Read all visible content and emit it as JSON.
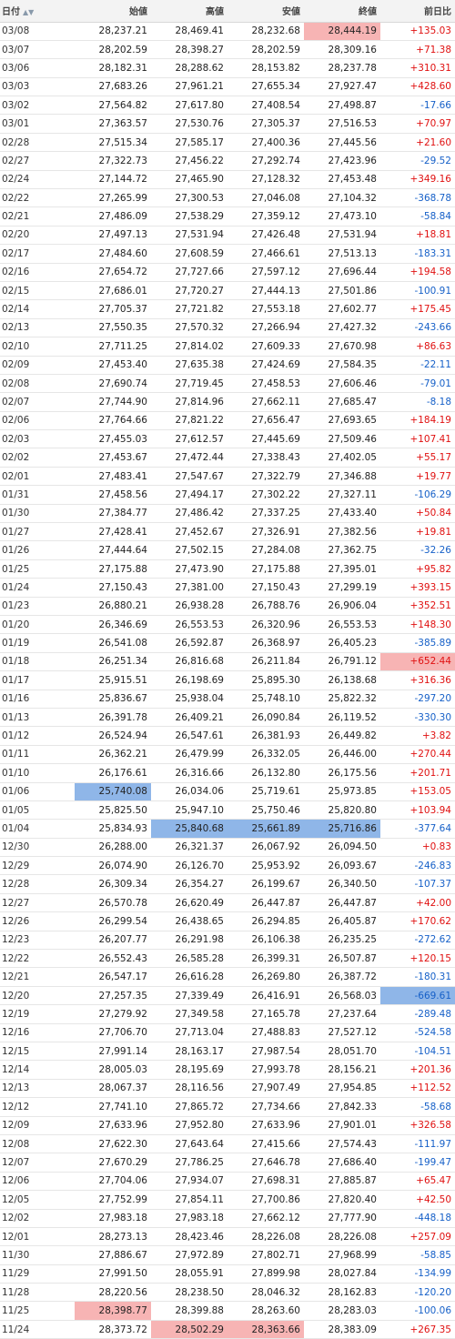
{
  "headers": {
    "date": "日付",
    "open": "始値",
    "high": "高値",
    "low": "安値",
    "close": "終値",
    "change": "前日比"
  },
  "sort_icons": "▲▼",
  "highlight_colors": {
    "high": "#f7b4b4",
    "low": "#8fb6e8",
    "positive": "#e01010",
    "negative": "#1660c8"
  },
  "rows": [
    {
      "date": "03/08",
      "open": "28,237.21",
      "high": "28,469.41",
      "low": "28,232.68",
      "close": "28,444.19",
      "change": "+135.03",
      "hl": {
        "close": "hi"
      }
    },
    {
      "date": "03/07",
      "open": "28,202.59",
      "high": "28,398.27",
      "low": "28,202.59",
      "close": "28,309.16",
      "change": "+71.38"
    },
    {
      "date": "03/06",
      "open": "28,182.31",
      "high": "28,288.62",
      "low": "28,153.82",
      "close": "28,237.78",
      "change": "+310.31"
    },
    {
      "date": "03/03",
      "open": "27,683.26",
      "high": "27,961.21",
      "low": "27,655.34",
      "close": "27,927.47",
      "change": "+428.60"
    },
    {
      "date": "03/02",
      "open": "27,564.82",
      "high": "27,617.80",
      "low": "27,408.54",
      "close": "27,498.87",
      "change": "-17.66"
    },
    {
      "date": "03/01",
      "open": "27,363.57",
      "high": "27,530.76",
      "low": "27,305.37",
      "close": "27,516.53",
      "change": "+70.97"
    },
    {
      "date": "02/28",
      "open": "27,515.34",
      "high": "27,585.17",
      "low": "27,400.36",
      "close": "27,445.56",
      "change": "+21.60"
    },
    {
      "date": "02/27",
      "open": "27,322.73",
      "high": "27,456.22",
      "low": "27,292.74",
      "close": "27,423.96",
      "change": "-29.52"
    },
    {
      "date": "02/24",
      "open": "27,144.72",
      "high": "27,465.90",
      "low": "27,128.32",
      "close": "27,453.48",
      "change": "+349.16"
    },
    {
      "date": "02/22",
      "open": "27,265.99",
      "high": "27,300.53",
      "low": "27,046.08",
      "close": "27,104.32",
      "change": "-368.78"
    },
    {
      "date": "02/21",
      "open": "27,486.09",
      "high": "27,538.29",
      "low": "27,359.12",
      "close": "27,473.10",
      "change": "-58.84"
    },
    {
      "date": "02/20",
      "open": "27,497.13",
      "high": "27,531.94",
      "low": "27,426.48",
      "close": "27,531.94",
      "change": "+18.81"
    },
    {
      "date": "02/17",
      "open": "27,484.60",
      "high": "27,608.59",
      "low": "27,466.61",
      "close": "27,513.13",
      "change": "-183.31"
    },
    {
      "date": "02/16",
      "open": "27,654.72",
      "high": "27,727.66",
      "low": "27,597.12",
      "close": "27,696.44",
      "change": "+194.58"
    },
    {
      "date": "02/15",
      "open": "27,686.01",
      "high": "27,720.27",
      "low": "27,444.13",
      "close": "27,501.86",
      "change": "-100.91"
    },
    {
      "date": "02/14",
      "open": "27,705.37",
      "high": "27,721.82",
      "low": "27,553.18",
      "close": "27,602.77",
      "change": "+175.45"
    },
    {
      "date": "02/13",
      "open": "27,550.35",
      "high": "27,570.32",
      "low": "27,266.94",
      "close": "27,427.32",
      "change": "-243.66"
    },
    {
      "date": "02/10",
      "open": "27,711.25",
      "high": "27,814.02",
      "low": "27,609.33",
      "close": "27,670.98",
      "change": "+86.63"
    },
    {
      "date": "02/09",
      "open": "27,453.40",
      "high": "27,635.38",
      "low": "27,424.69",
      "close": "27,584.35",
      "change": "-22.11"
    },
    {
      "date": "02/08",
      "open": "27,690.74",
      "high": "27,719.45",
      "low": "27,458.53",
      "close": "27,606.46",
      "change": "-79.01"
    },
    {
      "date": "02/07",
      "open": "27,744.90",
      "high": "27,814.96",
      "low": "27,662.11",
      "close": "27,685.47",
      "change": "-8.18"
    },
    {
      "date": "02/06",
      "open": "27,764.66",
      "high": "27,821.22",
      "low": "27,656.47",
      "close": "27,693.65",
      "change": "+184.19"
    },
    {
      "date": "02/03",
      "open": "27,455.03",
      "high": "27,612.57",
      "low": "27,445.69",
      "close": "27,509.46",
      "change": "+107.41"
    },
    {
      "date": "02/02",
      "open": "27,453.67",
      "high": "27,472.44",
      "low": "27,338.43",
      "close": "27,402.05",
      "change": "+55.17"
    },
    {
      "date": "02/01",
      "open": "27,483.41",
      "high": "27,547.67",
      "low": "27,322.79",
      "close": "27,346.88",
      "change": "+19.77"
    },
    {
      "date": "01/31",
      "open": "27,458.56",
      "high": "27,494.17",
      "low": "27,302.22",
      "close": "27,327.11",
      "change": "-106.29"
    },
    {
      "date": "01/30",
      "open": "27,384.77",
      "high": "27,486.42",
      "low": "27,337.25",
      "close": "27,433.40",
      "change": "+50.84"
    },
    {
      "date": "01/27",
      "open": "27,428.41",
      "high": "27,452.67",
      "low": "27,326.91",
      "close": "27,382.56",
      "change": "+19.81"
    },
    {
      "date": "01/26",
      "open": "27,444.64",
      "high": "27,502.15",
      "low": "27,284.08",
      "close": "27,362.75",
      "change": "-32.26"
    },
    {
      "date": "01/25",
      "open": "27,175.88",
      "high": "27,473.90",
      "low": "27,175.88",
      "close": "27,395.01",
      "change": "+95.82"
    },
    {
      "date": "01/24",
      "open": "27,150.43",
      "high": "27,381.00",
      "low": "27,150.43",
      "close": "27,299.19",
      "change": "+393.15"
    },
    {
      "date": "01/23",
      "open": "26,880.21",
      "high": "26,938.28",
      "low": "26,788.76",
      "close": "26,906.04",
      "change": "+352.51"
    },
    {
      "date": "01/20",
      "open": "26,346.69",
      "high": "26,553.53",
      "low": "26,320.96",
      "close": "26,553.53",
      "change": "+148.30"
    },
    {
      "date": "01/19",
      "open": "26,541.08",
      "high": "26,592.87",
      "low": "26,368.97",
      "close": "26,405.23",
      "change": "-385.89"
    },
    {
      "date": "01/18",
      "open": "26,251.34",
      "high": "26,816.68",
      "low": "26,211.84",
      "close": "26,791.12",
      "change": "+652.44",
      "hl": {
        "change": "hi"
      }
    },
    {
      "date": "01/17",
      "open": "25,915.51",
      "high": "26,198.69",
      "low": "25,895.30",
      "close": "26,138.68",
      "change": "+316.36"
    },
    {
      "date": "01/16",
      "open": "25,836.67",
      "high": "25,938.04",
      "low": "25,748.10",
      "close": "25,822.32",
      "change": "-297.20"
    },
    {
      "date": "01/13",
      "open": "26,391.78",
      "high": "26,409.21",
      "low": "26,090.84",
      "close": "26,119.52",
      "change": "-330.30"
    },
    {
      "date": "01/12",
      "open": "26,524.94",
      "high": "26,547.61",
      "low": "26,381.93",
      "close": "26,449.82",
      "change": "+3.82"
    },
    {
      "date": "01/11",
      "open": "26,362.21",
      "high": "26,479.99",
      "low": "26,332.05",
      "close": "26,446.00",
      "change": "+270.44"
    },
    {
      "date": "01/10",
      "open": "26,176.61",
      "high": "26,316.66",
      "low": "26,132.80",
      "close": "26,175.56",
      "change": "+201.71"
    },
    {
      "date": "01/06",
      "open": "25,740.08",
      "high": "26,034.06",
      "low": "25,719.61",
      "close": "25,973.85",
      "change": "+153.05",
      "hl": {
        "open": "lo"
      }
    },
    {
      "date": "01/05",
      "open": "25,825.50",
      "high": "25,947.10",
      "low": "25,750.46",
      "close": "25,820.80",
      "change": "+103.94"
    },
    {
      "date": "01/04",
      "open": "25,834.93",
      "high": "25,840.68",
      "low": "25,661.89",
      "close": "25,716.86",
      "change": "-377.64",
      "hl": {
        "high": "lo",
        "low": "lo",
        "close": "lo"
      }
    },
    {
      "date": "12/30",
      "open": "26,288.00",
      "high": "26,321.37",
      "low": "26,067.92",
      "close": "26,094.50",
      "change": "+0.83"
    },
    {
      "date": "12/29",
      "open": "26,074.90",
      "high": "26,126.70",
      "low": "25,953.92",
      "close": "26,093.67",
      "change": "-246.83"
    },
    {
      "date": "12/28",
      "open": "26,309.34",
      "high": "26,354.27",
      "low": "26,199.67",
      "close": "26,340.50",
      "change": "-107.37"
    },
    {
      "date": "12/27",
      "open": "26,570.78",
      "high": "26,620.49",
      "low": "26,447.87",
      "close": "26,447.87",
      "change": "+42.00"
    },
    {
      "date": "12/26",
      "open": "26,299.54",
      "high": "26,438.65",
      "low": "26,294.85",
      "close": "26,405.87",
      "change": "+170.62"
    },
    {
      "date": "12/23",
      "open": "26,207.77",
      "high": "26,291.98",
      "low": "26,106.38",
      "close": "26,235.25",
      "change": "-272.62"
    },
    {
      "date": "12/22",
      "open": "26,552.43",
      "high": "26,585.28",
      "low": "26,399.31",
      "close": "26,507.87",
      "change": "+120.15"
    },
    {
      "date": "12/21",
      "open": "26,547.17",
      "high": "26,616.28",
      "low": "26,269.80",
      "close": "26,387.72",
      "change": "-180.31"
    },
    {
      "date": "12/20",
      "open": "27,257.35",
      "high": "27,339.49",
      "low": "26,416.91",
      "close": "26,568.03",
      "change": "-669.61",
      "hl": {
        "change": "lo"
      }
    },
    {
      "date": "12/19",
      "open": "27,279.92",
      "high": "27,349.58",
      "low": "27,165.78",
      "close": "27,237.64",
      "change": "-289.48"
    },
    {
      "date": "12/16",
      "open": "27,706.70",
      "high": "27,713.04",
      "low": "27,488.83",
      "close": "27,527.12",
      "change": "-524.58"
    },
    {
      "date": "12/15",
      "open": "27,991.14",
      "high": "28,163.17",
      "low": "27,987.54",
      "close": "28,051.70",
      "change": "-104.51"
    },
    {
      "date": "12/14",
      "open": "28,005.03",
      "high": "28,195.69",
      "low": "27,993.78",
      "close": "28,156.21",
      "change": "+201.36"
    },
    {
      "date": "12/13",
      "open": "28,067.37",
      "high": "28,116.56",
      "low": "27,907.49",
      "close": "27,954.85",
      "change": "+112.52"
    },
    {
      "date": "12/12",
      "open": "27,741.10",
      "high": "27,865.72",
      "low": "27,734.66",
      "close": "27,842.33",
      "change": "-58.68"
    },
    {
      "date": "12/09",
      "open": "27,633.96",
      "high": "27,952.80",
      "low": "27,633.96",
      "close": "27,901.01",
      "change": "+326.58"
    },
    {
      "date": "12/08",
      "open": "27,622.30",
      "high": "27,643.64",
      "low": "27,415.66",
      "close": "27,574.43",
      "change": "-111.97"
    },
    {
      "date": "12/07",
      "open": "27,670.29",
      "high": "27,786.25",
      "low": "27,646.78",
      "close": "27,686.40",
      "change": "-199.47"
    },
    {
      "date": "12/06",
      "open": "27,704.06",
      "high": "27,934.07",
      "low": "27,698.31",
      "close": "27,885.87",
      "change": "+65.47"
    },
    {
      "date": "12/05",
      "open": "27,752.99",
      "high": "27,854.11",
      "low": "27,700.86",
      "close": "27,820.40",
      "change": "+42.50"
    },
    {
      "date": "12/02",
      "open": "27,983.18",
      "high": "27,983.18",
      "low": "27,662.12",
      "close": "27,777.90",
      "change": "-448.18"
    },
    {
      "date": "12/01",
      "open": "28,273.13",
      "high": "28,423.46",
      "low": "28,226.08",
      "close": "28,226.08",
      "change": "+257.09"
    },
    {
      "date": "11/30",
      "open": "27,886.67",
      "high": "27,972.89",
      "low": "27,802.71",
      "close": "27,968.99",
      "change": "-58.85"
    },
    {
      "date": "11/29",
      "open": "27,991.50",
      "high": "28,055.91",
      "low": "27,899.98",
      "close": "28,027.84",
      "change": "-134.99"
    },
    {
      "date": "11/28",
      "open": "28,220.56",
      "high": "28,238.50",
      "low": "28,046.32",
      "close": "28,162.83",
      "change": "-120.20"
    },
    {
      "date": "11/25",
      "open": "28,398.77",
      "high": "28,399.88",
      "low": "28,263.60",
      "close": "28,283.03",
      "change": "-100.06",
      "hl": {
        "open": "hi"
      }
    },
    {
      "date": "11/24",
      "open": "28,373.72",
      "high": "28,502.29",
      "low": "28,363.66",
      "close": "28,383.09",
      "change": "+267.35",
      "hl": {
        "high": "hi",
        "low": "hi"
      }
    }
  ]
}
